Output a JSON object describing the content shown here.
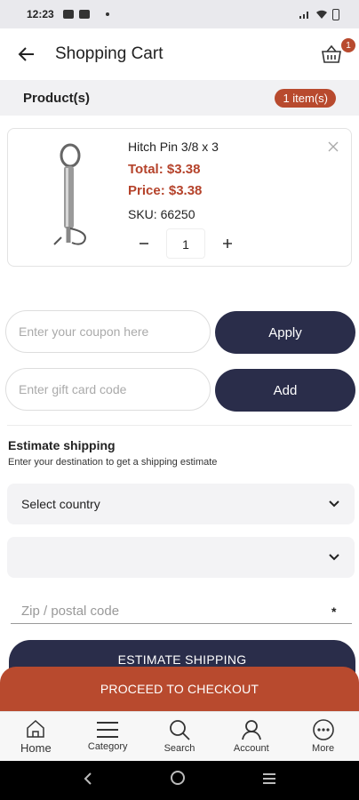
{
  "status_bar": {
    "time": "12:23"
  },
  "header": {
    "title": "Shopping Cart",
    "cart_count": "1"
  },
  "section": {
    "label": "Product(s)",
    "items_badge": "1 item(s)"
  },
  "product": {
    "name": "Hitch Pin 3/8 x 3",
    "total": "Total: $3.38",
    "price": "Price: $3.38",
    "sku": "SKU: 66250",
    "quantity": "1",
    "remove_icon": "close-icon"
  },
  "coupon": {
    "placeholder": "Enter your coupon here",
    "button": "Apply"
  },
  "gift_card": {
    "placeholder": "Enter gift card code",
    "button": "Add"
  },
  "shipping": {
    "title": "Estimate shipping",
    "subtitle": "Enter your destination to get a shipping estimate",
    "country_select": "Select country",
    "state_select": "",
    "zip_placeholder": "Zip / postal code",
    "required_mark": "*",
    "button": "ESTIMATE SHIPPING"
  },
  "checkout": {
    "button": "PROCEED TO CHECKOUT"
  },
  "bottom_nav": {
    "items": [
      {
        "label": "Home",
        "icon": "home-icon"
      },
      {
        "label": "Category",
        "icon": "menu-icon"
      },
      {
        "label": "Search",
        "icon": "search-icon"
      },
      {
        "label": "Account",
        "icon": "account-icon"
      },
      {
        "label": "More",
        "icon": "more-icon"
      }
    ]
  },
  "colors": {
    "accent": "#b84a2e",
    "primary_button": "#2a2d4a",
    "price_text": "#b5432b"
  }
}
